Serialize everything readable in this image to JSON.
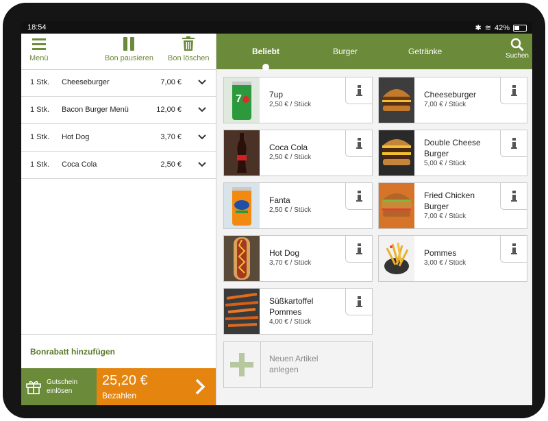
{
  "status_bar": {
    "time": "18:54",
    "battery": "42%"
  },
  "toolbar": {
    "menu_label": "Menü",
    "pause_label": "Bon pausieren",
    "delete_label": "Bon löschen"
  },
  "order": {
    "items": [
      {
        "qty": "1 Stk.",
        "name": "Cheeseburger",
        "price": "7,00 €"
      },
      {
        "qty": "1 Stk.",
        "name": "Bacon Burger Menü",
        "price": "12,00 €"
      },
      {
        "qty": "1 Stk.",
        "name": "Hot Dog",
        "price": "3,70 €"
      },
      {
        "qty": "1 Stk.",
        "name": "Coca Cola",
        "price": "2,50 €"
      }
    ],
    "discount_label": "Bonrabatt hinzufügen",
    "voucher_label_1": "Gutschein",
    "voucher_label_2": "einlösen",
    "total": "25,20 €",
    "pay_label": "Bezahlen"
  },
  "tabs": [
    "Beliebt",
    "Burger",
    "Getränke"
  ],
  "search_label": "Suchen",
  "products": [
    {
      "name": "7up",
      "price": "2,50 € / Stück",
      "image": "7up-can"
    },
    {
      "name": "Cheeseburger",
      "price": "7,00 € / Stück",
      "image": "cheeseburger"
    },
    {
      "name": "Coca Cola",
      "price": "2,50 € / Stück",
      "image": "coca-cola-bottle"
    },
    {
      "name": "Double Cheese Burger",
      "price": "5,00 € / Stück",
      "image": "double-cheese-burger"
    },
    {
      "name": "Fanta",
      "price": "2,50 € / Stück",
      "image": "fanta-can"
    },
    {
      "name": "Fried Chicken Burger",
      "price": "7,00 € / Stück",
      "image": "fried-chicken-burger"
    },
    {
      "name": "Hot Dog",
      "price": "3,70 € / Stück",
      "image": "hot-dog"
    },
    {
      "name": "Pommes",
      "price": "3,00 € / Stück",
      "image": "pommes"
    },
    {
      "name": "Süßkartoffel Pommes",
      "price": "4,00 € / Stück",
      "image": "suesskartoffel-pommes"
    }
  ],
  "new_item_label_1": "Neuen Artikel",
  "new_item_label_2": "anlegen",
  "colors": {
    "accent_green": "#6b8a3a",
    "pay_orange": "#e5850f"
  }
}
